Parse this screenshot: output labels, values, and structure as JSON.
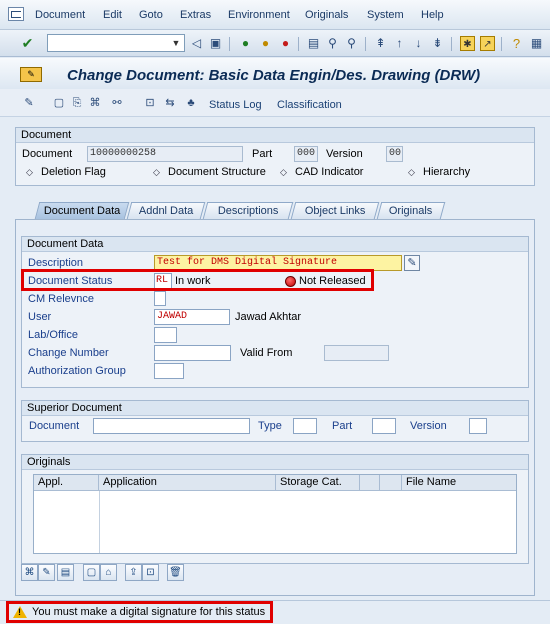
{
  "menubar": {
    "items": [
      "Document",
      "Edit",
      "Goto",
      "Extras",
      "Environment",
      "Originals",
      "System",
      "Help"
    ]
  },
  "toolbar": {
    "command_value": ""
  },
  "header": {
    "title": "Change Document: Basic Data Engin/Des. Drawing (DRW)"
  },
  "app_toolbar": {
    "status_log_label": "Status Log",
    "classification_label": "Classification"
  },
  "document_group": {
    "title": "Document",
    "document_label": "Document",
    "document_value": "10000000258",
    "part_label": "Part",
    "part_value": "000",
    "version_label": "Version",
    "version_value": "00",
    "flags": [
      "Deletion Flag",
      "Document Structure",
      "CAD Indicator",
      "Hierarchy"
    ]
  },
  "tabs": [
    "Document Data",
    "Addnl Data",
    "Descriptions",
    "Object Links",
    "Originals"
  ],
  "document_data": {
    "title": "Document Data",
    "description_label": "Description",
    "description_value": "Test for DMS Digital Signature",
    "status_label": "Document Status",
    "status_code": "RL",
    "status_text": "In work",
    "release_text": "Not Released",
    "cm_label": "CM Relevnce",
    "user_label": "User",
    "user_value": "JAWAD",
    "user_name": "Jawad Akhtar",
    "lab_label": "Lab/Office",
    "change_label": "Change Number",
    "valid_from_label": "Valid From",
    "auth_label": "Authorization Group"
  },
  "superior_document": {
    "title": "Superior Document",
    "document_label": "Document",
    "type_label": "Type",
    "part_label": "Part",
    "version_label": "Version"
  },
  "originals": {
    "title": "Originals",
    "columns": [
      "Appl.",
      "Application",
      "Storage Cat.",
      "",
      "",
      "File Name"
    ]
  },
  "status_bar": {
    "message": "You must make a digital signature for this status"
  },
  "colors": {
    "highlight": "#e00000",
    "link": "#1a3f8c",
    "description_bg": "#fdf3a2"
  }
}
